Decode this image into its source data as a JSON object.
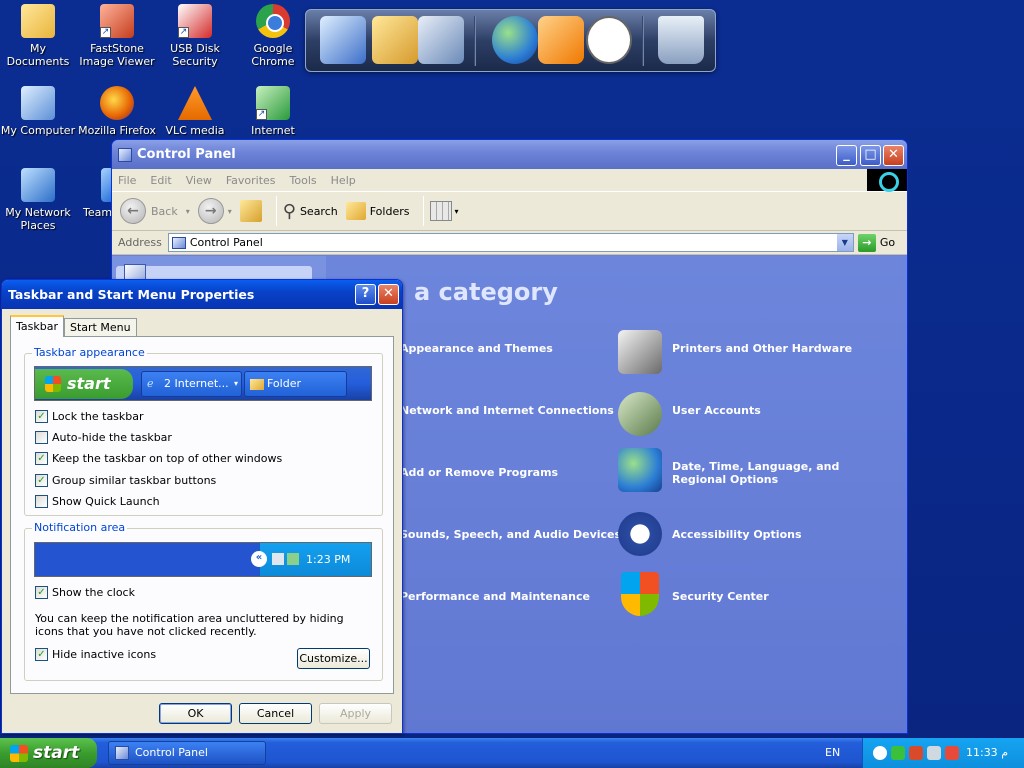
{
  "desktop": {
    "icons": [
      {
        "label": "My Documents",
        "icon": "my-documents-icon"
      },
      {
        "label": "FastStone Image Viewer",
        "icon": "faststone-icon"
      },
      {
        "label": "USB Disk Security",
        "icon": "usb-disk-security-icon"
      },
      {
        "label": "Google Chrome",
        "icon": "chrome-icon"
      },
      {
        "label": "My Computer",
        "icon": "my-computer-icon"
      },
      {
        "label": "Mozilla Firefox",
        "icon": "firefox-icon"
      },
      {
        "label": "VLC media",
        "icon": "vlc-icon"
      },
      {
        "label": "Internet",
        "icon": "internet-icon"
      },
      {
        "label": "My Network Places",
        "icon": "network-places-icon"
      },
      {
        "label": "Team",
        "icon": "team-icon"
      }
    ]
  },
  "control_panel": {
    "title": "Control Panel",
    "menu": [
      "File",
      "Edit",
      "View",
      "Favorites",
      "Tools",
      "Help"
    ],
    "toolbar": {
      "back": "Back",
      "search": "Search",
      "folders": "Folders"
    },
    "address_label": "Address",
    "address_value": "Control Panel",
    "go_label": "Go",
    "heading": "a category",
    "categories_left": [
      "Appearance and Themes",
      "Network and Internet Connections",
      "Add or Remove Programs",
      "Sounds, Speech, and Audio Devices",
      "Performance and Maintenance"
    ],
    "categories_right": [
      "Printers and Other Hardware",
      "User Accounts",
      "Date, Time, Language, and Regional Options",
      "Accessibility Options",
      "Security Center"
    ]
  },
  "dialog": {
    "title": "Taskbar and Start Menu Properties",
    "tabs": [
      "Taskbar",
      "Start Menu"
    ],
    "appearance_group": "Taskbar appearance",
    "preview_start": "start",
    "preview_btn1": "2 Internet...",
    "preview_btn2": "Folder",
    "checkboxes": [
      {
        "label": "Lock the taskbar",
        "checked": true
      },
      {
        "label": "Auto-hide the taskbar",
        "checked": false
      },
      {
        "label": "Keep the taskbar on top of other windows",
        "checked": true
      },
      {
        "label": "Group similar taskbar buttons",
        "checked": true
      },
      {
        "label": "Show Quick Launch",
        "checked": false
      }
    ],
    "notification_group": "Notification area",
    "preview_time": "1:23 PM",
    "show_clock": {
      "label": "Show the clock",
      "checked": true
    },
    "info_text": "You can keep the notification area uncluttered by hiding icons that you have not clicked recently.",
    "hide_inactive": {
      "label": "Hide inactive icons",
      "checked": true
    },
    "customize": "Customize...",
    "ok": "OK",
    "cancel": "Cancel",
    "apply": "Apply"
  },
  "taskbar": {
    "start": "start",
    "task": "Control Panel",
    "lang": "EN",
    "time": "11:33 م"
  }
}
